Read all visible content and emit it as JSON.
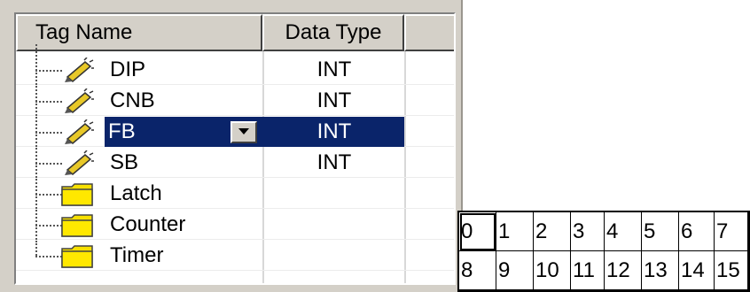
{
  "tag_table": {
    "columns": {
      "tag_name": "Tag Name",
      "data_type": "Data Type"
    },
    "rows": [
      {
        "label": "DIP",
        "type": "INT",
        "icon": "tag-pencil-icon"
      },
      {
        "label": "CNB",
        "type": "INT",
        "icon": "tag-pencil-icon"
      },
      {
        "label": "FB",
        "type": "INT",
        "icon": "tag-pencil-icon",
        "selected": true
      },
      {
        "label": "SB",
        "type": "INT",
        "icon": "tag-pencil-icon"
      },
      {
        "label": "Latch",
        "type": "",
        "icon": "folder-icon"
      },
      {
        "label": "Counter",
        "type": "",
        "icon": "folder-icon"
      },
      {
        "label": "Timer",
        "type": "",
        "icon": "folder-icon"
      }
    ]
  },
  "bit_picker": {
    "bits": [
      "0",
      "1",
      "2",
      "3",
      "4",
      "5",
      "6",
      "7",
      "8",
      "9",
      "10",
      "11",
      "12",
      "13",
      "14",
      "15"
    ],
    "selected": "0"
  }
}
